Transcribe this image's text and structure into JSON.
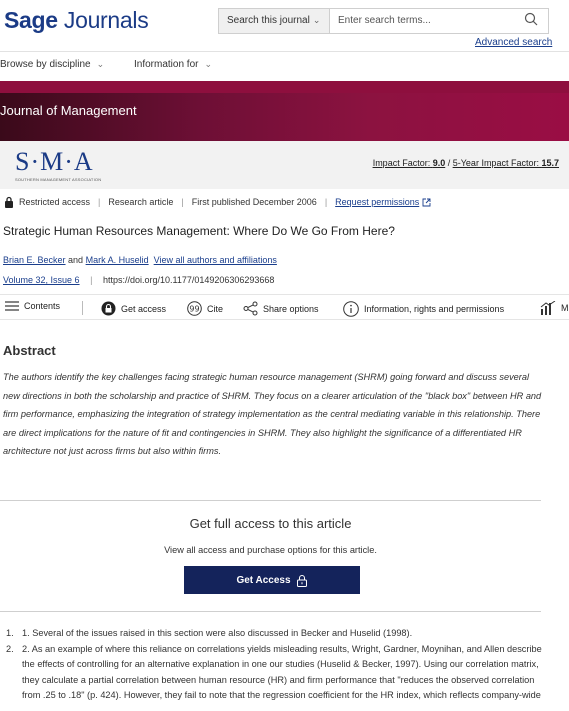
{
  "header": {
    "logo_bold": "Sage",
    "logo_rest": "Journals",
    "search_scope": "Search this journal",
    "search_placeholder": "Enter search terms...",
    "advanced_search": "Advanced search"
  },
  "nav": {
    "items": [
      {
        "label": "Browse by discipline"
      },
      {
        "label": "Information for"
      }
    ]
  },
  "journal": {
    "title": "Journal of Management",
    "society_logo": "S·M·A",
    "society_sub": "SOUTHERN MANAGEMENT ASSOCIATION",
    "impact_label": "Impact Factor:",
    "impact_value": "9.0",
    "five_year_label": "5-Year Impact Factor:",
    "five_year_value": "15.7",
    "brand_color": "#8c1240"
  },
  "article": {
    "access": "Restricted access",
    "type": "Research article",
    "published": "First published December 2006",
    "request_permissions": "Request permissions",
    "title": "Strategic Human Resources Management: Where Do We Go From Here?",
    "author1": "Brian E. Becker",
    "and": "and",
    "author2": "Mark A. Huselid",
    "view_all": "View all authors and affiliations",
    "volume": "Volume 32, Issue 6",
    "doi": "https://doi.org/10.1177/0149206306293668"
  },
  "toolbar": {
    "contents": "Contents",
    "get_access": "Get access",
    "cite": "Cite",
    "share": "Share options",
    "info": "Information, rights and permissions",
    "metrics": "M"
  },
  "abstract": {
    "heading": "Abstract",
    "text": "The authors identify the key challenges facing strategic human resource management (SHRM) going forward and discuss several new directions in both the scholarship and practice of SHRM. They focus on a clearer articulation of the \"black box\" between HR and firm performance, emphasizing the integration of strategy implementation as the central mediating variable in this relationship. There are direct implications for the nature of fit and contingencies in SHRM. They also highlight the significance of a differentiated HR architecture not just across firms but also within firms."
  },
  "access_box": {
    "heading": "Get full access to this article",
    "sub": "View all access and purchase options for this article.",
    "button": "Get Access"
  },
  "notes": [
    {
      "num": "1.",
      "text": "1. Several of the issues raised in this section were also discussed in Becker and Huselid (1998)."
    },
    {
      "num": "2.",
      "text": "2. As an example of where this reliance on correlations yields misleading results, Wright, Gardner, Moynihan, and Allen describe the effects of controlling for an alternative explanation in one our studies (Huselid & Becker, 1997). Using our correlation matrix, they calculate a partial correlation between human resource (HR) and firm performance that \"reduces the observed correlation from .25 to .18\" (p. 424). However, they fail to note that the regression coefficient for the HR index, which reflects company-wide"
    }
  ]
}
